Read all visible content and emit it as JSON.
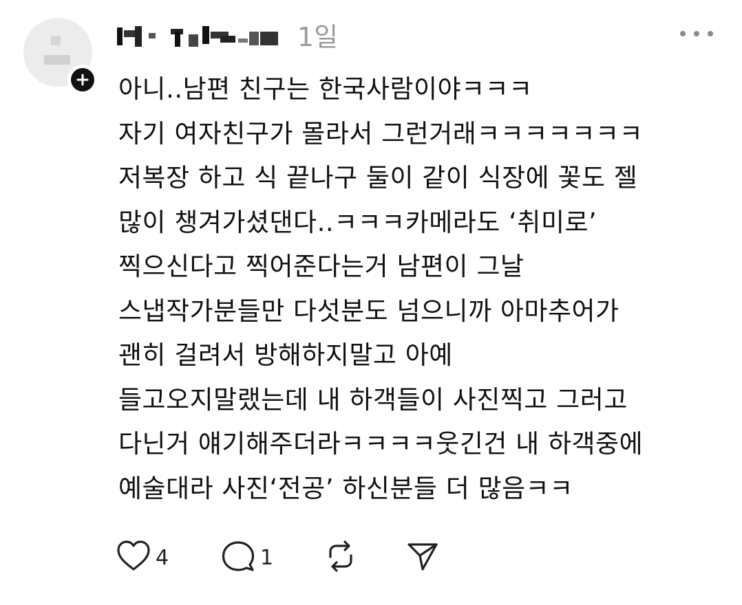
{
  "post": {
    "username": "",
    "timestamp": "1일"
  },
  "comment": {
    "lines": [
      "아니..남편 친구는 한국사람이야ㅋㅋㅋ",
      "자기 여자친구가 몰라서 그런거래ㅋㅋㅋㅋㅋㅋㅋ",
      "저복장 하고 식 끝나구 둘이 같이 식장에 꽃도 젤",
      "많이 챙겨가셨댄다..ㅋㅋㅋ카메라도 ‘취미로’",
      "찍으신다고 찍어준다는거 남편이 그날",
      "스냅작가분들만 다섯분도 넘으니까 아마추어가",
      "괜히 걸려서 방해하지말고 아예",
      "들고오지말랬는데 내 하객들이 사진찍고 그러고",
      "다닌거 얘기해주더라ㅋㅋㅋㅋ웃긴건 내 하객중에",
      "예술대라 사진‘전공’ 하신분들 더 많음ㅋㅋ"
    ]
  },
  "actions": {
    "like_count": "4",
    "reply_count": "1"
  },
  "icons": {
    "avatar": "avatar-placeholder",
    "follow": "plus-icon",
    "more": "more-icon",
    "like": "heart-icon",
    "reply": "comment-icon",
    "repost": "repost-icon",
    "share": "send-icon"
  }
}
